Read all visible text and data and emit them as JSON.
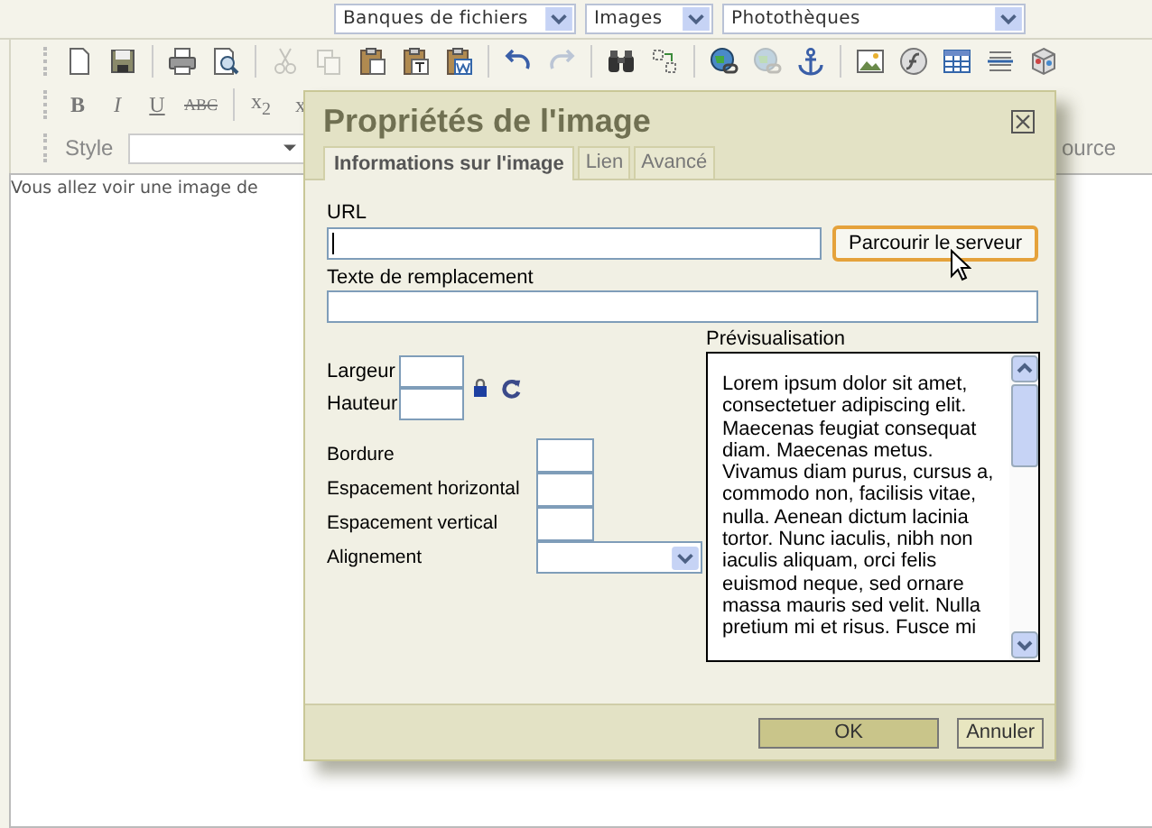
{
  "top_selects": [
    {
      "value": "Banques de fichiers"
    },
    {
      "value": "Images"
    },
    {
      "value": "Photothèques"
    }
  ],
  "toolbar_tools": [
    {
      "disabled": false
    },
    {
      "disabled": false
    },
    {
      "disabled": false
    },
    {
      "disabled": false
    },
    {
      "disabled": true
    },
    {
      "disabled": true
    },
    {
      "disabled": false
    },
    {
      "disabled": false
    },
    {
      "disabled": false
    },
    {
      "disabled": false
    },
    {
      "disabled": true
    },
    {
      "disabled": false
    },
    {
      "disabled": false
    },
    {
      "disabled": false
    },
    {
      "disabled": true
    },
    {
      "disabled": false
    },
    {
      "disabled": false
    },
    {
      "disabled": false
    },
    {
      "disabled": false
    },
    {
      "disabled": false
    },
    {
      "disabled": false
    }
  ],
  "format_buttons": [
    "B",
    "I",
    "U",
    "ABC",
    "x$_{2}$",
    "x"
  ],
  "style_label": "Style",
  "source_button": "ource",
  "editor_text": "Vous allez voir une image de",
  "dialog": {
    "title": "Propriétés de l'image",
    "tabs": [
      {
        "label": "Informations sur l'image",
        "selected": true
      },
      {
        "label": "Lien",
        "selected": false
      },
      {
        "label": "Avancé",
        "selected": false
      }
    ],
    "url_label": "URL",
    "browse_button": "Parcourir le serveur",
    "alt_label": "Texte de remplacement",
    "width_label": "Largeur",
    "height_label": "Hauteur",
    "border_label": "Bordure",
    "hspace_label": "Espacement horizontal",
    "vspace_label": "Espacement vertical",
    "align_label": "Alignement",
    "preview_label": "Prévisualisation",
    "preview_text": "Lorem ipsum dolor sit amet, consectetuer adipiscing elit. Maecenas feugiat consequat diam. Maecenas metus. Vivamus diam purus, cursus a, commodo non, facilisis vitae, nulla. Aenean dictum lacinia tortor. Nunc iaculis, nibh non iaculis aliquam, orci felis euismod neque, sed ornare massa mauris sed velit. Nulla pretium mi et risus. Fusce mi",
    "ok_button": "OK",
    "cancel_button": "Annuler"
  }
}
